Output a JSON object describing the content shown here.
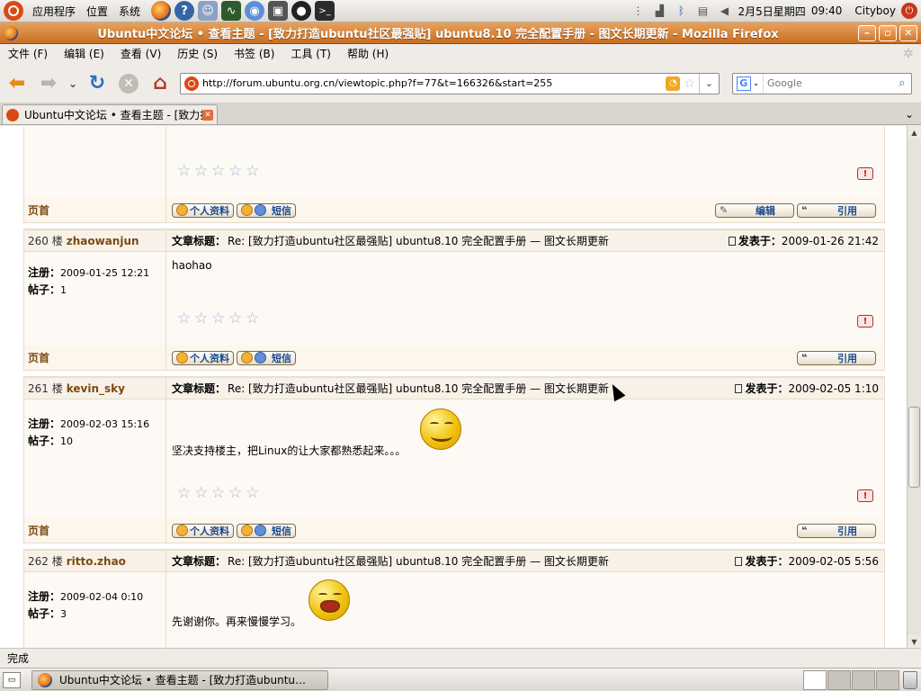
{
  "panel": {
    "menus": [
      "应用程序",
      "位置",
      "系统"
    ],
    "date": "2月5日星期四",
    "time": "09:40",
    "user": "Cityboy"
  },
  "window": {
    "title": "Ubuntu中文论坛 • 查看主题 - [致力打造ubuntu社区最强贴] ubuntu8.10 完全配置手册 - 图文长期更新 - Mozilla Firefox"
  },
  "menubar": {
    "items": [
      "文件 (F)",
      "编辑 (E)",
      "查看 (V)",
      "历史 (S)",
      "书签 (B)",
      "工具 (T)",
      "帮助 (H)"
    ]
  },
  "navbar": {
    "url": "http://forum.ubuntu.org.cn/viewtopic.php?f=77&t=166326&start=255",
    "search_placeholder": "Google"
  },
  "tabs": [
    {
      "label": "Ubuntu中文论坛 • 查看主题 - [致力打…"
    }
  ],
  "forum": {
    "labels": {
      "subject": "文章标题：",
      "posted": "发表于：",
      "registered": "注册：",
      "posts": "帖子：",
      "top": "页首",
      "profile": "个人资料",
      "pm": "短信",
      "edit": "编辑",
      "quote": "引用"
    },
    "posts": [
      {
        "floor": "260 楼",
        "username": "zhaowanjun",
        "subject": "Re: [致力打造ubuntu社区最强贴] ubuntu8.10 完全配置手册 — 图文长期更新",
        "posted": "2009-01-26 21:42",
        "registered": "2009-01-25 12:21",
        "post_count": "1",
        "body": "haohao"
      },
      {
        "floor": "261 楼",
        "username": "kevin_sky",
        "subject": "Re: [致力打造ubuntu社区最强贴] ubuntu8.10 完全配置手册 — 图文长期更新",
        "posted": "2009-02-05 1:10",
        "registered": "2009-02-03 15:16",
        "post_count": "10",
        "body": "坚决支持楼主，把Linux的让大家都熟悉起来。。。"
      },
      {
        "floor": "262 楼",
        "username": "ritto.zhao",
        "subject": "Re: [致力打造ubuntu社区最强贴] ubuntu8.10 完全配置手册 — 图文长期更新",
        "posted": "2009-02-05 5:56",
        "registered": "2009-02-04 0:10",
        "post_count": "3",
        "body": "先谢谢你。再来慢慢学习。"
      }
    ]
  },
  "status": {
    "text": "完成"
  },
  "taskbar": {
    "item": "Ubuntu中文论坛 • 查看主题 - [致力打造ubuntu…"
  },
  "colors": {
    "titlebar": "#c96e23",
    "username": "#7b4a14",
    "post_bg": "#fdf9f4"
  }
}
